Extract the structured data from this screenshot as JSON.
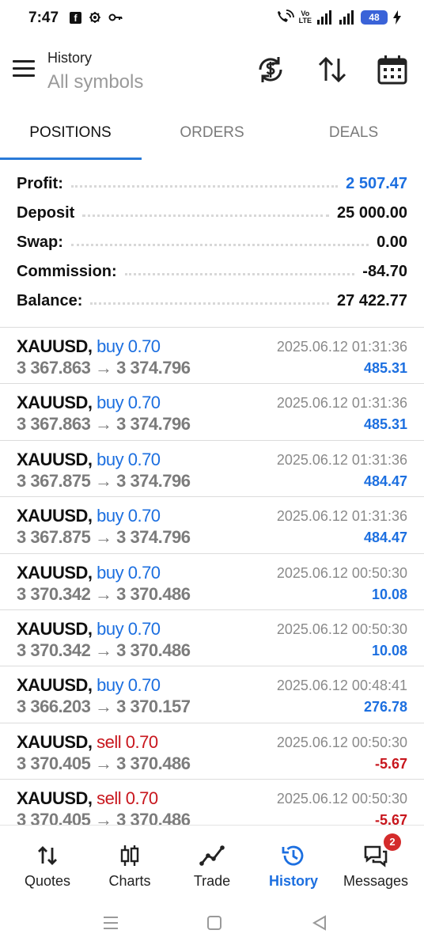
{
  "status_bar": {
    "time": "7:47",
    "battery": "48",
    "icons": [
      "facebook-icon",
      "settings-cog-icon",
      "key-icon",
      "wifi-calling-icon",
      "volte-icon",
      "signal-icon",
      "signal-icon",
      "charging-icon"
    ],
    "volte_top": "Vo",
    "volte_bottom": "LTE"
  },
  "header": {
    "title": "History",
    "subtitle": "All symbols",
    "icons": [
      "menu-icon",
      "currency-swap-icon",
      "sort-icon",
      "calendar-icon"
    ]
  },
  "tabs": [
    {
      "label": "POSITIONS",
      "active": true
    },
    {
      "label": "ORDERS",
      "active": false
    },
    {
      "label": "DEALS",
      "active": false
    }
  ],
  "accent_color": "#1c6fe0",
  "negative_color": "#c8161d",
  "summary": [
    {
      "label": "Profit:",
      "value": "2 507.47"
    },
    {
      "label": "Deposit",
      "value": "25 000.00"
    },
    {
      "label": "Swap:",
      "value": "0.00"
    },
    {
      "label": "Commission:",
      "value": "-84.70"
    },
    {
      "label": "Balance:",
      "value": "27 422.77"
    }
  ],
  "deals": [
    {
      "symbol": "XAUUSD,",
      "side": "buy 0.70",
      "prices": "3 367.863 → 3 374.796",
      "time": "2025.06.12 01:31:36",
      "profit": "485.31"
    },
    {
      "symbol": "XAUUSD,",
      "side": "buy 0.70",
      "prices": "3 367.863 → 3 374.796",
      "time": "2025.06.12 01:31:36",
      "profit": "485.31"
    },
    {
      "symbol": "XAUUSD,",
      "side": "buy 0.70",
      "prices": "3 367.875 → 3 374.796",
      "time": "2025.06.12 01:31:36",
      "profit": "484.47"
    },
    {
      "symbol": "XAUUSD,",
      "side": "buy 0.70",
      "prices": "3 367.875 → 3 374.796",
      "time": "2025.06.12 01:31:36",
      "profit": "484.47"
    },
    {
      "symbol": "XAUUSD,",
      "side": "buy 0.70",
      "prices": "3 370.342 → 3 370.486",
      "time": "2025.06.12 00:50:30",
      "profit": "10.08"
    },
    {
      "symbol": "XAUUSD,",
      "side": "buy 0.70",
      "prices": "3 370.342 → 3 370.486",
      "time": "2025.06.12 00:50:30",
      "profit": "10.08"
    },
    {
      "symbol": "XAUUSD,",
      "side": "buy 0.70",
      "prices": "3 366.203 → 3 370.157",
      "time": "2025.06.12 00:48:41",
      "profit": "276.78"
    },
    {
      "symbol": "XAUUSD,",
      "side": "sell 0.70",
      "prices": "3 370.405 → 3 370.486",
      "time": "2025.06.12 00:50:30",
      "profit": "-5.67"
    },
    {
      "symbol": "XAUUSD,",
      "side": "sell 0.70",
      "prices": "3 370.405 → 3 370.486",
      "time": "2025.06.12 00:50:30",
      "profit": "-5.67"
    }
  ],
  "bottom_nav": [
    {
      "label": "Quotes",
      "icon": "quotes-arrows-icon",
      "active": false
    },
    {
      "label": "Charts",
      "icon": "candlestick-icon",
      "active": false
    },
    {
      "label": "Trade",
      "icon": "trade-line-icon",
      "active": false
    },
    {
      "label": "History",
      "icon": "history-clock-icon",
      "active": true
    },
    {
      "label": "Messages",
      "icon": "messages-icon",
      "active": false,
      "badge": "2"
    }
  ],
  "system_nav": [
    "recent-apps-icon",
    "home-icon",
    "back-icon"
  ]
}
